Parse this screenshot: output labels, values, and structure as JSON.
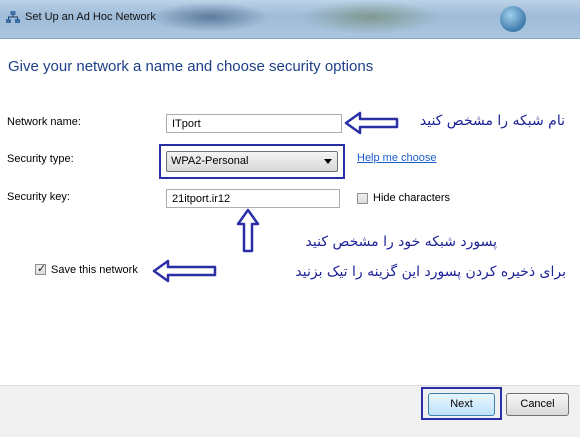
{
  "window": {
    "title": "Set Up an Ad Hoc Network"
  },
  "heading": "Give your network a name and choose security options",
  "fields": {
    "network_name_label": "Network name:",
    "network_name_value": "ITport",
    "security_type_label": "Security type:",
    "security_type_value": "WPA2-Personal",
    "help_link": "Help me choose",
    "security_key_label": "Security key:",
    "security_key_value": "21itport.ir12",
    "hide_characters_label": "Hide characters",
    "hide_characters_checked": false,
    "save_network_label": "Save this network",
    "save_network_checked": true
  },
  "annotations": {
    "name_note": "نام شبکه را مشخص کنید",
    "password_note": "پسورد شبکه خود را مشخص کنید",
    "save_note": "برای ذخیره کردن پسورد این گزینه را تیک بزنید",
    "color": "#1d2396"
  },
  "buttons": {
    "next": "Next",
    "cancel": "Cancel"
  },
  "icons": {
    "title": "network-icon",
    "dropdown": "chevron-down-icon",
    "annotation_arrow": "hollow-arrow-icon"
  }
}
